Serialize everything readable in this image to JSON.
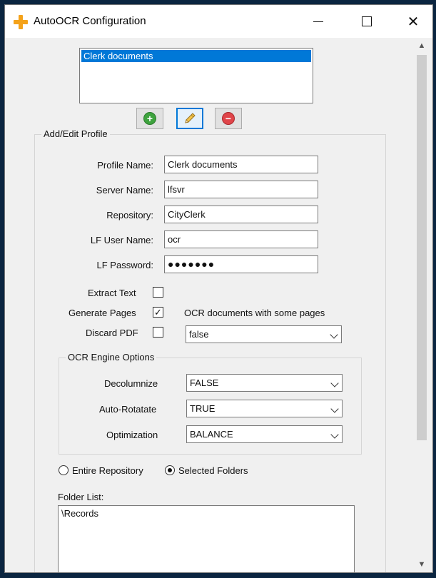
{
  "window": {
    "title": "AutoOCR Configuration",
    "icon": "plus-icon",
    "accent_color": "#f4a21a",
    "controls": {
      "minimize": "minimize-icon",
      "maximize": "maximize-icon",
      "close": "✕"
    }
  },
  "profiles": {
    "items": [
      "Clerk documents"
    ],
    "selected": "Clerk documents",
    "selection_color": "#0078d7"
  },
  "toolbar": {
    "add": "add-icon",
    "edit": "pencil-icon",
    "remove": "remove-icon"
  },
  "edit_profile": {
    "legend": "Add/Edit Profile",
    "profile_name_label": "Profile Name:",
    "profile_name_value": "Clerk documents",
    "server_name_label": "Server Name:",
    "server_name_value": "lfsvr",
    "repository_label": "Repository:",
    "repository_value": "CityClerk",
    "lf_user_label": "LF User Name:",
    "lf_user_value": "ocr",
    "lf_password_label": "LF Password:",
    "lf_password_value": "●●●●●●●"
  },
  "options": {
    "extract_text_label": "Extract Text",
    "extract_text_checked": false,
    "generate_pages_label": "Generate Pages",
    "generate_pages_checked": true,
    "discard_pdf_label": "Discard PDF",
    "discard_pdf_checked": false,
    "check_mark": "✓",
    "ocr_some_pages_label": "OCR documents with some pages",
    "ocr_some_pages_value": "false"
  },
  "ocr_engine": {
    "legend": "OCR Engine Options",
    "decolumnize_label": "Decolumnize",
    "decolumnize_value": "FALSE",
    "autorotate_label": "Auto-Rotatate",
    "autorotate_value": "TRUE",
    "optimization_label": "Optimization",
    "optimization_value": "BALANCE"
  },
  "scope": {
    "entire_repository_label": "Entire Repository",
    "selected_folders_label": "Selected Folders",
    "selected": "Selected Folders"
  },
  "folders": {
    "label": "Folder List:",
    "items": [
      "\\Records"
    ]
  }
}
